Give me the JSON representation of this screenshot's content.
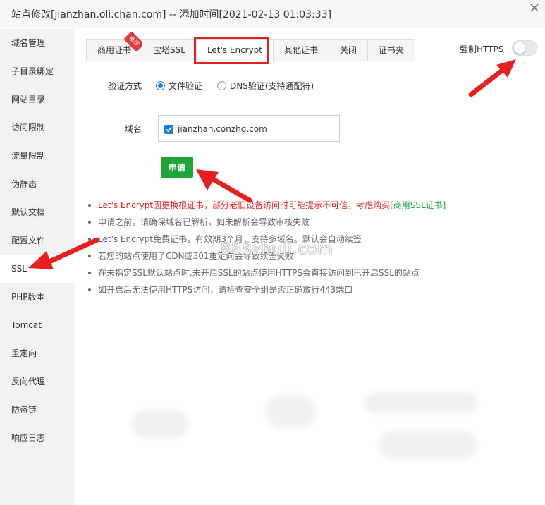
{
  "window": {
    "title": "站点修改[jianzhan.oli.chan.com] -- 添加时间[2021-02-13 01:03:33]"
  },
  "sidebar": {
    "items": [
      {
        "label": "域名管理"
      },
      {
        "label": "子目录绑定"
      },
      {
        "label": "网站目录"
      },
      {
        "label": "访问限制"
      },
      {
        "label": "流量限制"
      },
      {
        "label": "伪静态"
      },
      {
        "label": "默认文档"
      },
      {
        "label": "配置文件"
      },
      {
        "label": "SSL",
        "active": true
      },
      {
        "label": "PHP版本"
      },
      {
        "label": "Tomcat"
      },
      {
        "label": "重定向"
      },
      {
        "label": "反向代理"
      },
      {
        "label": "防盗链"
      },
      {
        "label": "响应日志"
      }
    ]
  },
  "tabs": [
    {
      "label": "商用证书",
      "badge": "推荐"
    },
    {
      "label": "宝塔SSL"
    },
    {
      "label": "Let's Encrypt",
      "active": true
    },
    {
      "label": "其他证书"
    },
    {
      "label": "关闭"
    },
    {
      "label": "证书夹"
    }
  ],
  "force_https": {
    "label": "强制HTTPS",
    "enabled": false
  },
  "verify": {
    "label": "验证方式",
    "options": [
      {
        "label": "文件验证",
        "selected": true
      },
      {
        "label": "DNS验证(支持通配符)",
        "selected": false
      }
    ]
  },
  "domain": {
    "label": "域名",
    "items": [
      {
        "name": "jianzhan.conzhg.com",
        "checked": true
      }
    ]
  },
  "apply_button": "申请",
  "tips": [
    {
      "text": "Let's Encrypt因更换根证书，部分老旧设备访问时可能提示不可信，考虑购买",
      "link": "[商用SSL证书]",
      "red": true
    },
    {
      "text": "申请之前，请确保域名已解析，如未解析会导致审核失败"
    },
    {
      "text": "Let's Encrypt免费证书，有效期3个月，支持多域名。默认会自动续签"
    },
    {
      "text": "若您的站点使用了CDN或301重定向会导致续签失败"
    },
    {
      "text": "在未指定SSL默认站点时,未开启SSL的站点使用HTTPS会直接访问到已开启SSL的站点"
    },
    {
      "text": "如开启后无法使用HTTPS访问，请检查安全组是否正确放行443端口"
    }
  ],
  "watermark": "888zhuji.com",
  "colors": {
    "accent_green": "#20a53a",
    "highlight_red": "#e62020",
    "radio_blue": "#1e7fd6",
    "sidebar_bg": "#f2f2f2"
  },
  "icons": [
    "close-icon",
    "checkbox-checked-icon",
    "arrow-annotation-icon"
  ]
}
